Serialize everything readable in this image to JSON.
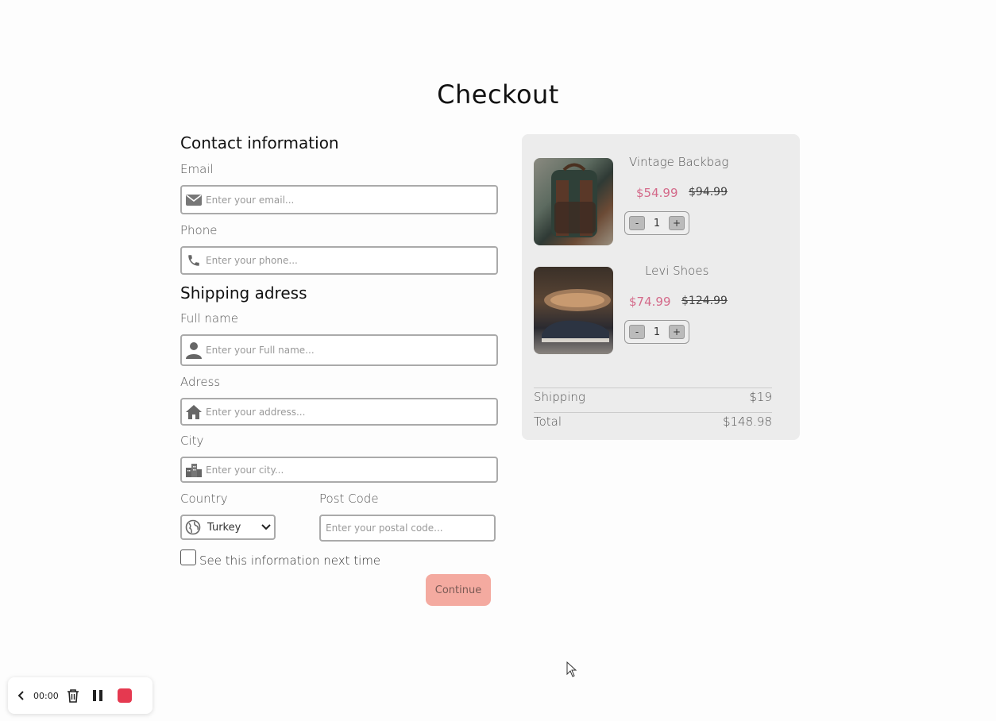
{
  "page": {
    "title": "Checkout"
  },
  "contact": {
    "title": "Contact information",
    "email_label": "Email",
    "email_placeholder": "Enter your email...",
    "phone_label": "Phone",
    "phone_placeholder": "Enter your phone..."
  },
  "shipping": {
    "title": "Shipping adress",
    "fullname_label": "Full name",
    "fullname_placeholder": "Enter your Full name...",
    "address_label": "Adress",
    "address_placeholder": "Enter your address...",
    "city_label": "City",
    "city_placeholder": "Enter your city...",
    "country_label": "Country",
    "country_value": "Turkey",
    "postcode_label": "Post Code",
    "postcode_placeholder": "Enter your postal code..."
  },
  "remember": {
    "label": "See this information next time",
    "checked": false
  },
  "continue_label": "Continue",
  "cart": {
    "items": [
      {
        "name": "Vintage Backbag",
        "price": "$54.99",
        "old_price": "$94.99",
        "qty": "1",
        "minus": "-",
        "plus": "+"
      },
      {
        "name": "Levi Shoes",
        "price": "$74.99",
        "old_price": "$124.99",
        "qty": "1",
        "minus": "-",
        "plus": "+"
      }
    ],
    "shipping_label": "Shipping",
    "shipping_value": "$19",
    "total_label": "Total",
    "total_value": "$148.98"
  },
  "recorder": {
    "time": "00:00"
  },
  "colors": {
    "accent": "#f4aaa0",
    "price": "#d46a8a",
    "stop": "#e53950"
  }
}
